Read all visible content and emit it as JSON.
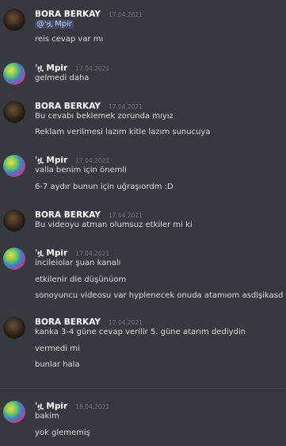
{
  "messages": [
    {
      "author": "BORA BERKAY",
      "timestamp": "17.04.2021",
      "mention": "@'ዟ Mpir",
      "lines": [
        "reis cevap var mı"
      ]
    },
    {
      "author": "'ዟ Mpir",
      "timestamp": "17.04.2021",
      "lines": [
        "gelmedi daha"
      ]
    },
    {
      "author": "BORA BERKAY",
      "timestamp": "17.04.2021",
      "lines": [
        "Bu cevabı beklemek zorunda mıyız",
        "Reklam verilmesi lazım kitle lazım sunucuya"
      ]
    },
    {
      "author": "'ዟ Mpir",
      "timestamp": "17.04.2021",
      "lines": [
        "valla benim için önemli",
        "6-7 aydır bunun için uğraşıordm :D"
      ]
    },
    {
      "author": "BORA BERKAY",
      "timestamp": "17.04.2021",
      "lines": [
        "Bu videoyu atman olumsuz etkiler mi ki"
      ]
    },
    {
      "author": "'ዟ Mpir",
      "timestamp": "17.04.2021",
      "lines": [
        "incileiolar şuan kanalı",
        "etkilenir die düşünüom",
        "sonoyuncu videosu var hyplenecek onuda atamıom asdlşikasd"
      ]
    },
    {
      "author": "BORA BERKAY",
      "timestamp": "17.04.2021",
      "lines": [
        "kanka 3-4 güne cevap verilir 5. güne atarım dediydin",
        "vermedi mi",
        "bunlar hala"
      ]
    },
    {
      "author": "'ዟ Mpir",
      "timestamp": "18.04.2021",
      "lines": [
        "bakim",
        "yok glememiş"
      ]
    }
  ]
}
